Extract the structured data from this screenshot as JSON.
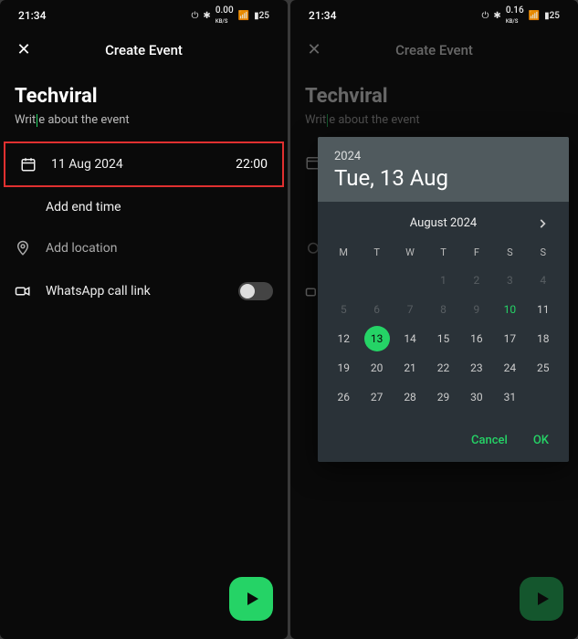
{
  "statusTime": "21:34",
  "statusNet1": "0.00",
  "statusNet2": "0.16",
  "statusUnit": "KB/S",
  "battery": "25",
  "header": {
    "title": "Create Event"
  },
  "event": {
    "name": "Techviral",
    "descPrefix": "Writ",
    "descSuffix": "e about the event"
  },
  "datetime": {
    "date": "11 Aug 2024",
    "time": "22:00"
  },
  "addEndTime": "Add end time",
  "addLocation": "Add location",
  "callLink": "WhatsApp call link",
  "dialog": {
    "year": "2024",
    "fullDate": "Tue, 13 Aug",
    "monthYear": "August 2024",
    "weekdays": [
      "M",
      "T",
      "W",
      "T",
      "F",
      "S",
      "S"
    ],
    "cancel": "Cancel",
    "ok": "OK"
  },
  "calendarDays": [
    {
      "n": "",
      "t": "blank"
    },
    {
      "n": "",
      "t": "blank"
    },
    {
      "n": "",
      "t": "blank"
    },
    {
      "n": "1",
      "t": "prev"
    },
    {
      "n": "2",
      "t": "prev"
    },
    {
      "n": "3",
      "t": "prev"
    },
    {
      "n": "4",
      "t": "prev"
    },
    {
      "n": "5",
      "t": "prev"
    },
    {
      "n": "6",
      "t": "prev"
    },
    {
      "n": "7",
      "t": "prev"
    },
    {
      "n": "8",
      "t": "prev"
    },
    {
      "n": "9",
      "t": "prev"
    },
    {
      "n": "10",
      "t": "today"
    },
    {
      "n": "11",
      "t": ""
    },
    {
      "n": "12",
      "t": ""
    },
    {
      "n": "13",
      "t": "sel"
    },
    {
      "n": "14",
      "t": ""
    },
    {
      "n": "15",
      "t": ""
    },
    {
      "n": "16",
      "t": ""
    },
    {
      "n": "17",
      "t": ""
    },
    {
      "n": "18",
      "t": ""
    },
    {
      "n": "19",
      "t": ""
    },
    {
      "n": "20",
      "t": ""
    },
    {
      "n": "21",
      "t": ""
    },
    {
      "n": "22",
      "t": ""
    },
    {
      "n": "23",
      "t": ""
    },
    {
      "n": "24",
      "t": ""
    },
    {
      "n": "25",
      "t": ""
    },
    {
      "n": "26",
      "t": ""
    },
    {
      "n": "27",
      "t": ""
    },
    {
      "n": "28",
      "t": ""
    },
    {
      "n": "29",
      "t": ""
    },
    {
      "n": "30",
      "t": ""
    },
    {
      "n": "31",
      "t": ""
    },
    {
      "n": "",
      "t": "blank"
    }
  ]
}
